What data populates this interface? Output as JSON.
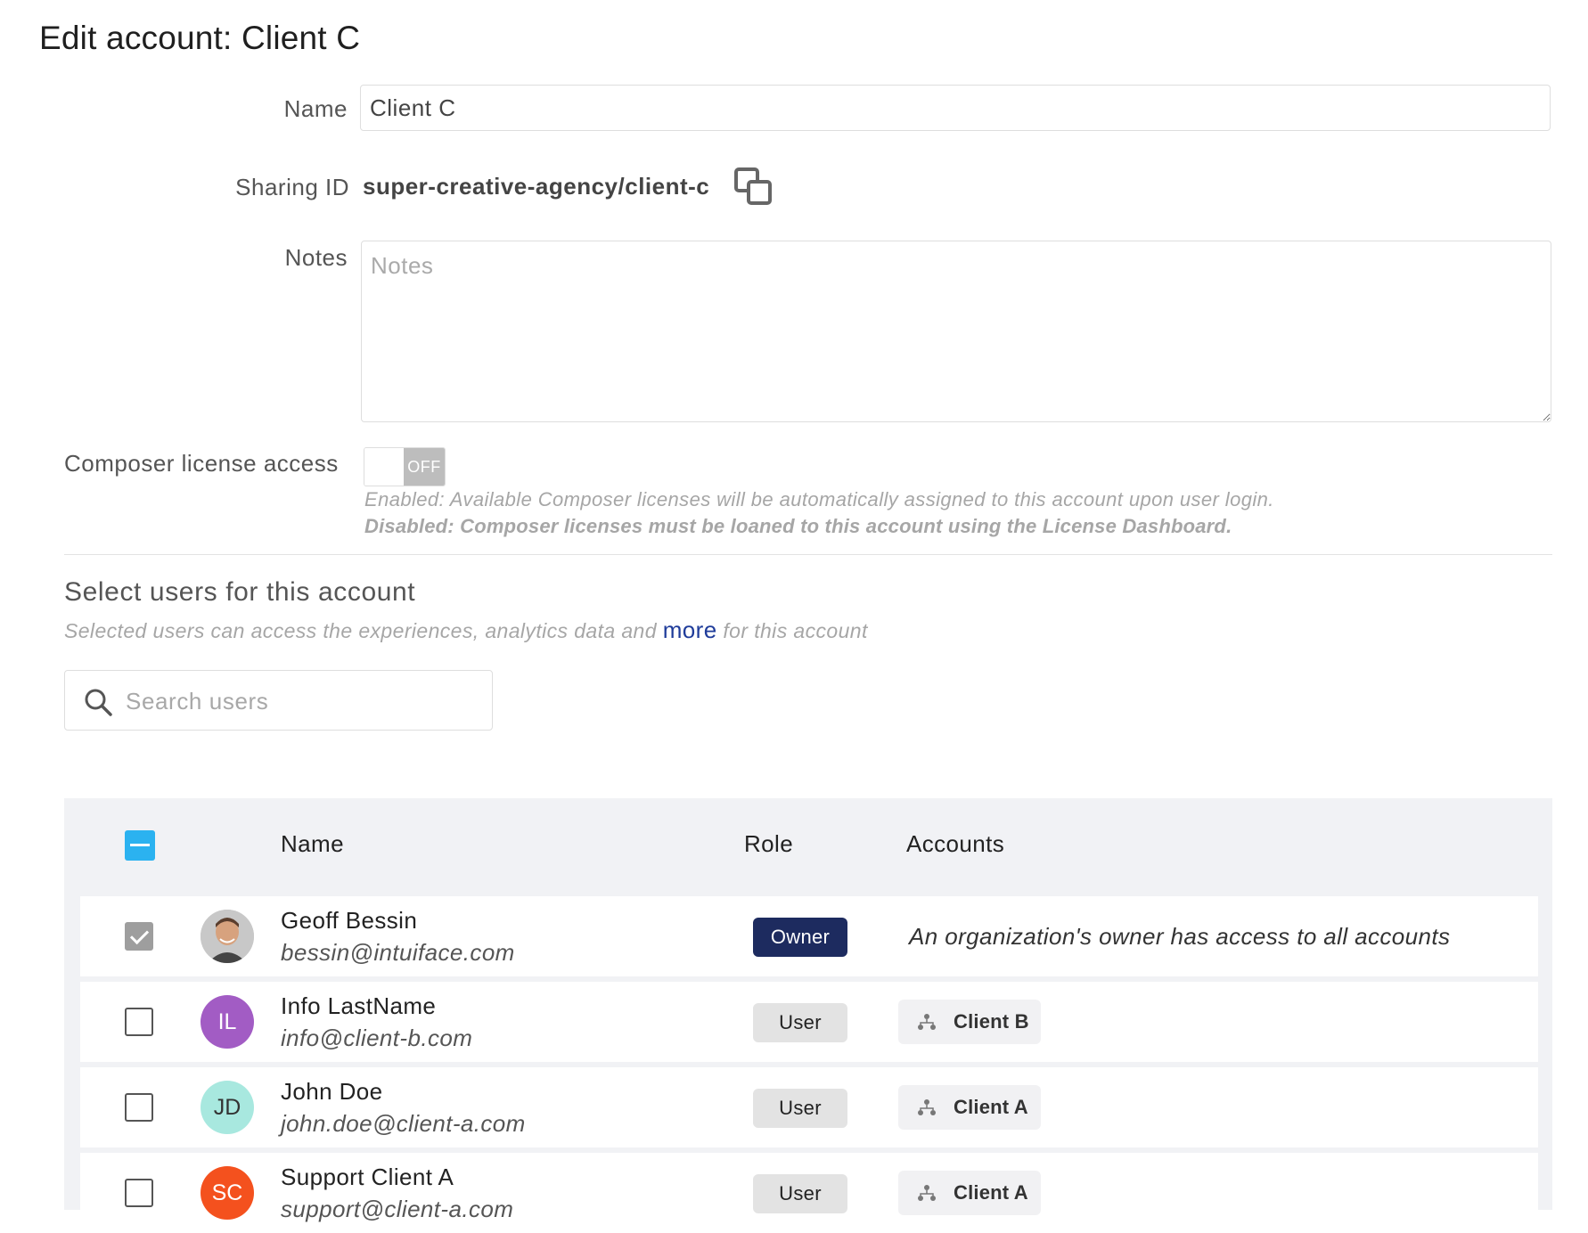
{
  "page": {
    "title": "Edit account: Client C"
  },
  "form": {
    "name_label": "Name",
    "name_value": "Client C",
    "sharing_label": "Sharing ID",
    "sharing_value": "super-creative-agency/client-c",
    "notes_label": "Notes",
    "notes_placeholder": "Notes",
    "composer_label": "Composer license access",
    "toggle_state": "OFF",
    "help_enabled": "Enabled: Available Composer licenses will be automatically assigned to this account upon user login.",
    "help_disabled": "Disabled: Composer licenses must be loaned to this account using the License Dashboard."
  },
  "users_section": {
    "title": "Select users for this account",
    "subtitle_before": "Selected users can access the experiences, analytics data and ",
    "more_link": "more",
    "subtitle_after": " for this account",
    "search_placeholder": "Search users"
  },
  "table": {
    "headers": {
      "name": "Name",
      "role": "Role",
      "accounts": "Accounts"
    },
    "rows": [
      {
        "name": "Geoff Bessin",
        "email": "bessin@intuiface.com",
        "role": "Owner",
        "checked": true,
        "accounts_note": "An organization's owner has access to all accounts",
        "avatar": "photo"
      },
      {
        "name": "Info LastName",
        "email": "info@client-b.com",
        "role": "User",
        "initials": "IL",
        "avatar_color": "#a25cc4",
        "account": "Client B"
      },
      {
        "name": "John Doe",
        "email": "john.doe@client-a.com",
        "role": "User",
        "initials": "JD",
        "avatar_color": "#a8e8df",
        "initials_color": "#333333",
        "account": "Client A"
      },
      {
        "name": "Support Client A",
        "email": "support@client-a.com",
        "role": "User",
        "initials": "SC",
        "avatar_color": "#f4511e",
        "account": "Client A"
      }
    ]
  },
  "colors": {
    "accent_blue": "#2bb2f0",
    "owner_badge": "#1d2b5f",
    "link": "#1f3c9a"
  },
  "icons": {
    "copy": "copy-icon",
    "search": "search-icon",
    "account": "sitemap-icon"
  }
}
